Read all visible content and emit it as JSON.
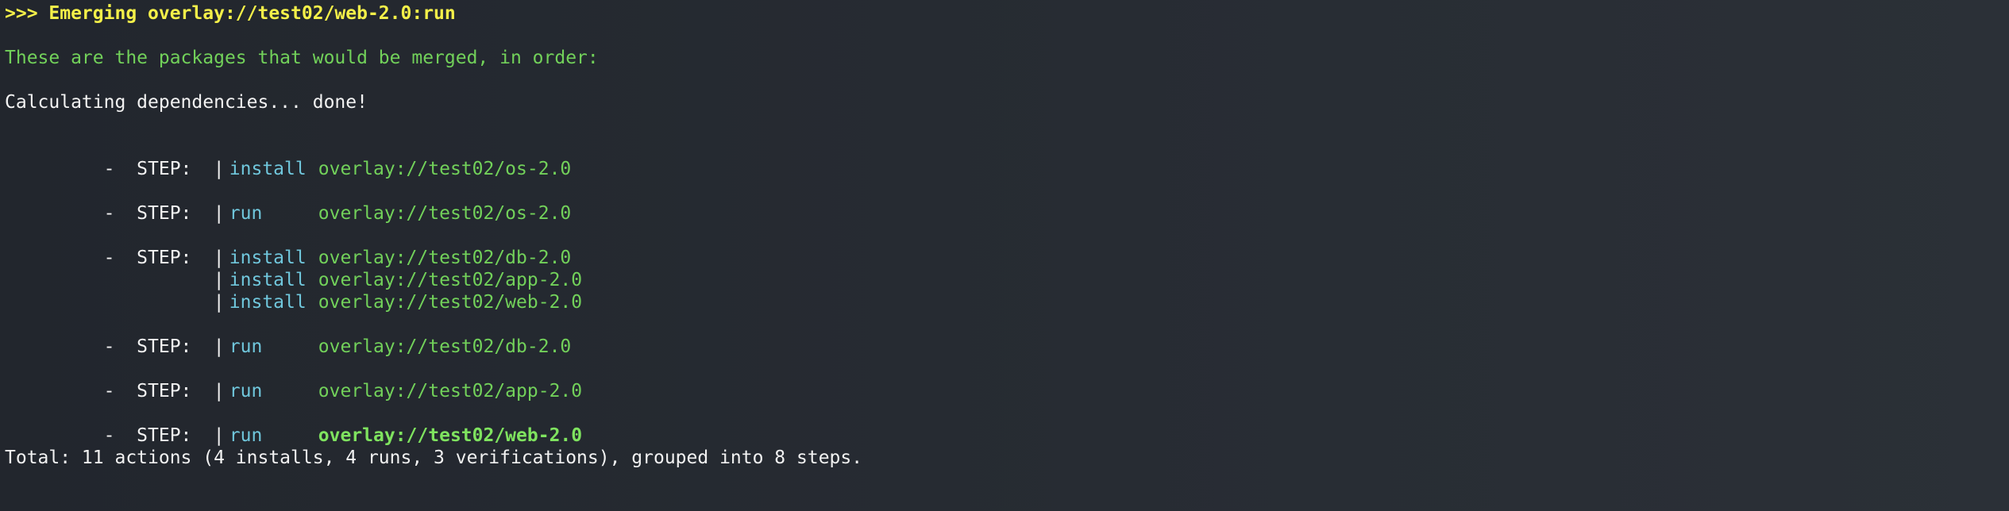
{
  "terminal": {
    "header": ">>> Emerging overlay://test02/web-2.0:run",
    "intro": "These are the packages that would be merged, in order:",
    "calculating": "Calculating dependencies... done!",
    "steps": [
      {
        "prefix": " -  STEP:  ",
        "rows": [
          {
            "pipe": "|",
            "action": "install",
            "package": "overlay://test02/os-2.0"
          }
        ]
      },
      {
        "prefix": " -  STEP:  ",
        "rows": [
          {
            "pipe": "|",
            "action": "run",
            "package": "overlay://test02/os-2.0"
          }
        ]
      },
      {
        "prefix": " -  STEP:  ",
        "rows": [
          {
            "pipe": "|",
            "action": "install",
            "package": "overlay://test02/db-2.0"
          },
          {
            "pipe": "|",
            "action": "install",
            "package": "overlay://test02/app-2.0"
          },
          {
            "pipe": "|",
            "action": "install",
            "package": "overlay://test02/web-2.0"
          }
        ]
      },
      {
        "prefix": " -  STEP:  ",
        "rows": [
          {
            "pipe": "|",
            "action": "run",
            "package": "overlay://test02/db-2.0"
          }
        ]
      },
      {
        "prefix": " -  STEP:  ",
        "rows": [
          {
            "pipe": "|",
            "action": "run",
            "package": "overlay://test02/app-2.0"
          }
        ]
      },
      {
        "prefix": " -  STEP:  ",
        "rows": [
          {
            "pipe": "|",
            "action": "run",
            "package": "overlay://test02/web-2.0",
            "highlight": true
          }
        ]
      }
    ],
    "total": "Total: 11 actions (4 installs, 4 runs, 3 verifications), grouped into 8 steps."
  },
  "colors": {
    "background": "#262b32",
    "header": "#f4f049",
    "green": "#72d15a",
    "cyan": "#70c7dc",
    "text": "#f2f2f2"
  }
}
